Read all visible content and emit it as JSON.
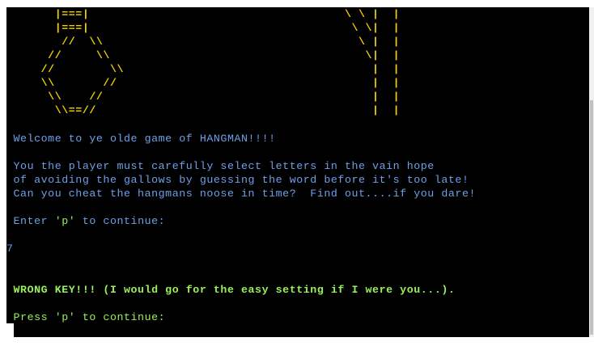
{
  "ascii_art": {
    "lines": [
      "       |===|                                     \\ \\ |  |",
      "       |===|                                      \\ \\|  |",
      "        //  \\\\                                     \\ |  |",
      "      //     \\\\                                     \\|  |",
      "     //        \\\\                                    |  |",
      "     \\\\       //                                     |  |",
      "      \\\\    //                                       |  |",
      "       \\\\==//                                        |  |"
    ]
  },
  "messages": {
    "welcome": " Welcome to ye olde game of HANGMAN!!!!",
    "intro_1": " You the player must carefully select letters in the vain hope",
    "intro_2": " of avoiding the gallows by guessing the word before it's too late!",
    "intro_3": " Can you cheat the hangmans noose in time?  Find out....if you dare!",
    "prompt_prefix": " Enter ",
    "prompt_key": "'p'",
    "prompt_suffix": " to continue:",
    "user_input": "7",
    "error": " WRONG KEY!!! (I would go for the easy setting if I were you...).",
    "press_prompt": " Press 'p' to continue:"
  },
  "colors": {
    "background": "#000000",
    "text_blue": "#6ea0e8",
    "text_green": "#9af05a",
    "ascii_yellow": "#f0d000"
  }
}
